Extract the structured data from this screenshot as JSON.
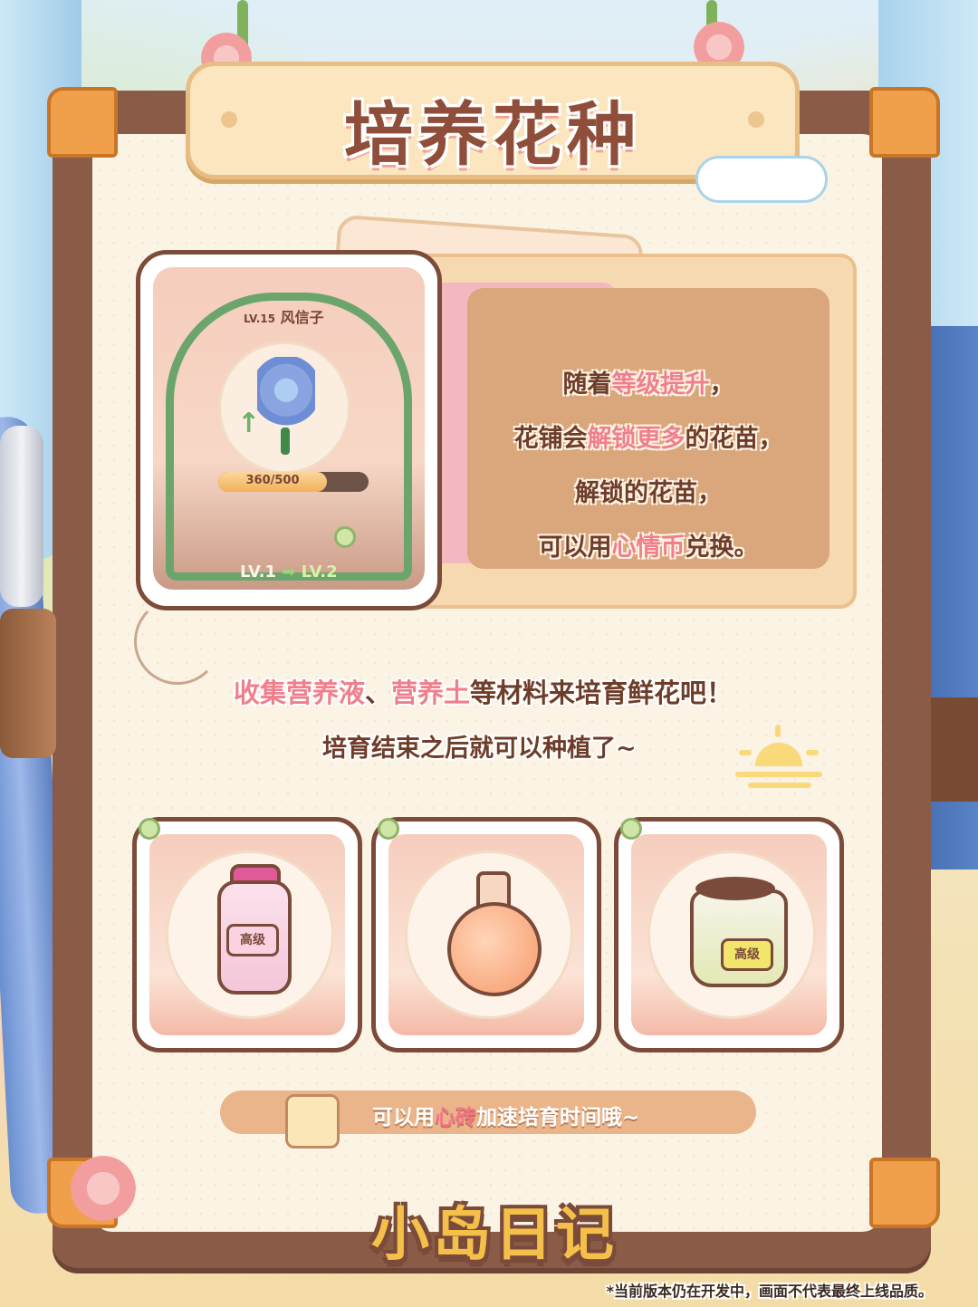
{
  "title": "培养花种",
  "plant_card": {
    "level_label": "LV.15",
    "plant_name": "风信子",
    "progress_text": "360/500",
    "progress_fraction": 0.72,
    "from_level": "LV.1",
    "to_level": "LV.2",
    "arrow_glyph": "➡"
  },
  "info_text": {
    "l1_a": "随着",
    "l1_hl": "等级提升",
    "l1_b": "，",
    "l2_a": "花铺会",
    "l2_hl": "解锁更多",
    "l2_b": "的花苗，",
    "l3": "解锁的花苗，",
    "l4_a": "可以用",
    "l4_hl": "心情币",
    "l4_b": "兑换。"
  },
  "message": {
    "m1_hl1": "收集营养液",
    "m1_sep": "、",
    "m1_hl2": "营养土",
    "m1_rest": "等材料来培育鲜花吧！",
    "m2": "培育结束之后就可以种植了~"
  },
  "items": [
    {
      "icon": "nutrient-bottle-icon",
      "tag": "高级"
    },
    {
      "icon": "potion-flask-icon",
      "tag": ""
    },
    {
      "icon": "soil-bag-icon",
      "tag": "高级"
    }
  ],
  "tip": {
    "a": "可以用",
    "hl": "心砖",
    "b": "加速培育时间哦~"
  },
  "logo": "小岛日记",
  "disclaimer": "*当前版本仍在开发中，画面不代表最终上线品质。",
  "colors": {
    "accent_pink": "#f07f8c",
    "text_brown": "#6e3d2a",
    "frame_brown": "#8a5b47",
    "corner_orange": "#f0a04a"
  }
}
